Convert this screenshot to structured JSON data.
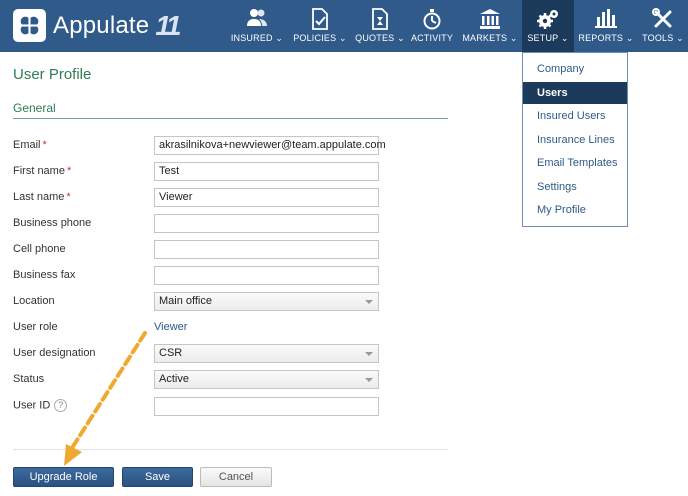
{
  "brand": {
    "name": "Appulate",
    "version_mark": "11"
  },
  "nav": {
    "items": [
      {
        "key": "insured",
        "label": "INSURED",
        "icon": "people-icon"
      },
      {
        "key": "policies",
        "label": "POLICIES",
        "icon": "document-check-icon"
      },
      {
        "key": "quotes",
        "label": "QUOTES",
        "icon": "document-hourglass-icon"
      },
      {
        "key": "activity",
        "label": "ACTIVITY",
        "icon": "stopwatch-icon"
      },
      {
        "key": "markets",
        "label": "MARKETS",
        "icon": "bank-icon"
      },
      {
        "key": "setup",
        "label": "SETUP",
        "icon": "gears-icon"
      },
      {
        "key": "reports",
        "label": "REPORTS",
        "icon": "bar-chart-icon"
      },
      {
        "key": "tools",
        "label": "TOOLS",
        "icon": "wrench-screwdriver-icon"
      }
    ],
    "active": "SETUP"
  },
  "setup_menu": {
    "items": [
      "Company",
      "Users",
      "Insured Users",
      "Insurance Lines",
      "Email Templates",
      "Settings",
      "My Profile"
    ],
    "active": "Users"
  },
  "page": {
    "title": "User Profile",
    "section": "General"
  },
  "form": {
    "email": {
      "label": "Email",
      "required": "*",
      "value": "akrasilnikova+newviewer@team.appulate.com"
    },
    "first_name": {
      "label": "First name",
      "required": "*",
      "value": "Test"
    },
    "last_name": {
      "label": "Last name",
      "required": "*",
      "value": "Viewer"
    },
    "business_phone": {
      "label": "Business phone",
      "value": ""
    },
    "cell_phone": {
      "label": "Cell phone",
      "value": ""
    },
    "business_fax": {
      "label": "Business fax",
      "value": ""
    },
    "location": {
      "label": "Location",
      "value": "Main office"
    },
    "user_role": {
      "label": "User role",
      "value": "Viewer"
    },
    "user_designation": {
      "label": "User designation",
      "value": "CSR"
    },
    "status": {
      "label": "Status",
      "value": "Active"
    },
    "user_id": {
      "label": "User ID",
      "help": "?",
      "value": ""
    }
  },
  "buttons": {
    "upgrade_role": "Upgrade Role",
    "save": "Save",
    "cancel": "Cancel"
  },
  "colors": {
    "header": "#2f5a8a",
    "header_active": "#1c3a5c",
    "accent_green": "#2e7d53",
    "annotation": "#f0a830"
  }
}
